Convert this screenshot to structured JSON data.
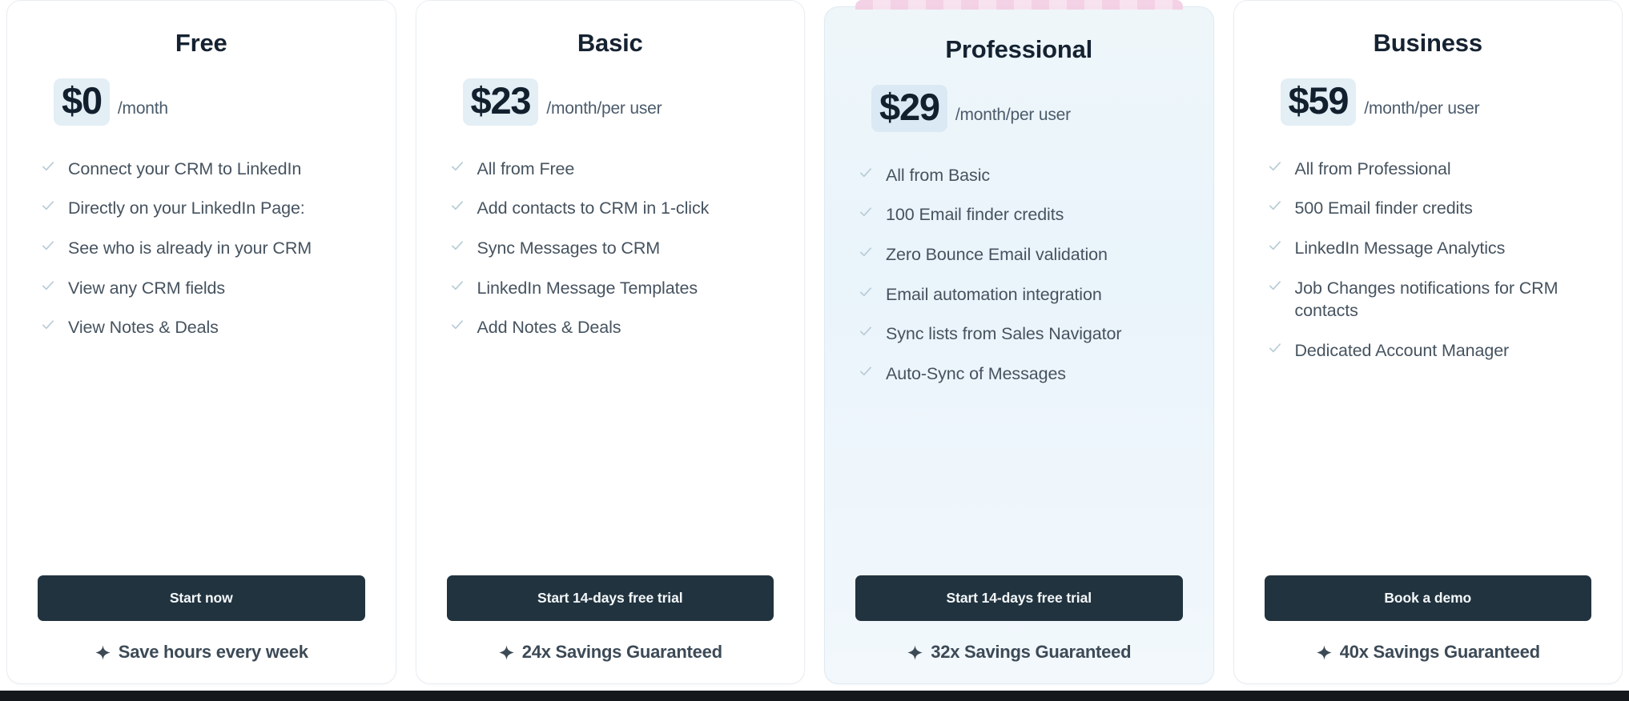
{
  "accent_colors": {
    "card_border": "#e9eef2",
    "featured_card_bg_top": "#eef6fa",
    "featured_card_bg_bottom": "#f2f8fc",
    "price_highlight_bg": "#e3eef5",
    "cta_button_bg": "#21333f",
    "cta_button_text": "#f3f7f9",
    "plan_name_text": "#152231",
    "feature_text": "#46535f",
    "check_icon": "#b8ccd6",
    "popular_ribbon": "#f3cfe4",
    "page_bottom_edge": "#14181c"
  },
  "icons": {
    "check": "check-icon",
    "sparkle": "sparkle-icon"
  },
  "plans": [
    {
      "id": "free",
      "name": "Free",
      "price": "$0",
      "period": "/month",
      "featured": false,
      "features": [
        "Connect your CRM to LinkedIn",
        "Directly on your LinkedIn Page:",
        "See who is already in your CRM",
        "View any CRM fields",
        "View Notes & Deals"
      ],
      "cta_label": "Start now",
      "tagline": "Save hours every week"
    },
    {
      "id": "basic",
      "name": "Basic",
      "price": "$23",
      "period": "/month/per user",
      "featured": false,
      "features": [
        "All from Free",
        "Add contacts to CRM in 1-click",
        "Sync Messages to CRM",
        "LinkedIn Message Templates",
        "Add Notes & Deals"
      ],
      "cta_label": "Start 14-days free trial",
      "tagline": "24x Savings Guaranteed"
    },
    {
      "id": "professional",
      "name": "Professional",
      "price": "$29",
      "period": "/month/per user",
      "featured": true,
      "features": [
        "All from Basic",
        "100 Email finder credits",
        "Zero Bounce Email validation",
        "Email automation integration",
        "Sync lists from Sales Navigator",
        "Auto-Sync of Messages"
      ],
      "cta_label": "Start 14-days free trial",
      "tagline": "32x Savings Guaranteed"
    },
    {
      "id": "business",
      "name": "Business",
      "price": "$59",
      "period": "/month/per user",
      "featured": false,
      "features": [
        "All from Professional",
        "500 Email finder credits",
        "LinkedIn Message Analytics",
        "Job Changes notifications for CRM contacts",
        "Dedicated Account Manager"
      ],
      "cta_label": "Book a demo",
      "tagline": "40x Savings Guaranteed"
    }
  ]
}
